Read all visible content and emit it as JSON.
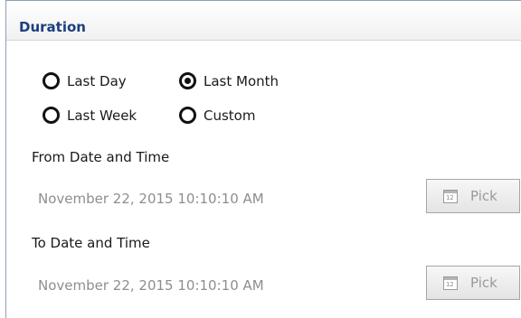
{
  "panel": {
    "title": "Duration"
  },
  "duration_options": [
    {
      "label": "Last Day",
      "checked": false
    },
    {
      "label": "Last Month",
      "checked": true
    },
    {
      "label": "Last Week",
      "checked": false
    },
    {
      "label": "Custom",
      "checked": false
    }
  ],
  "from": {
    "label": "From Date and Time",
    "value": "November 22, 2015 10:10:10 AM",
    "pick_label": "Pick",
    "pick_icon": "calendar-icon",
    "pick_icon_text": "12"
  },
  "to": {
    "label": "To Date and Time",
    "value": "November 22, 2015 10:10:10 AM",
    "pick_label": "Pick",
    "pick_icon": "calendar-icon",
    "pick_icon_text": "12"
  },
  "colors": {
    "title": "#1c3f80",
    "disabled_text": "#8e8e8e",
    "panel_border": "#8a9fb8"
  }
}
